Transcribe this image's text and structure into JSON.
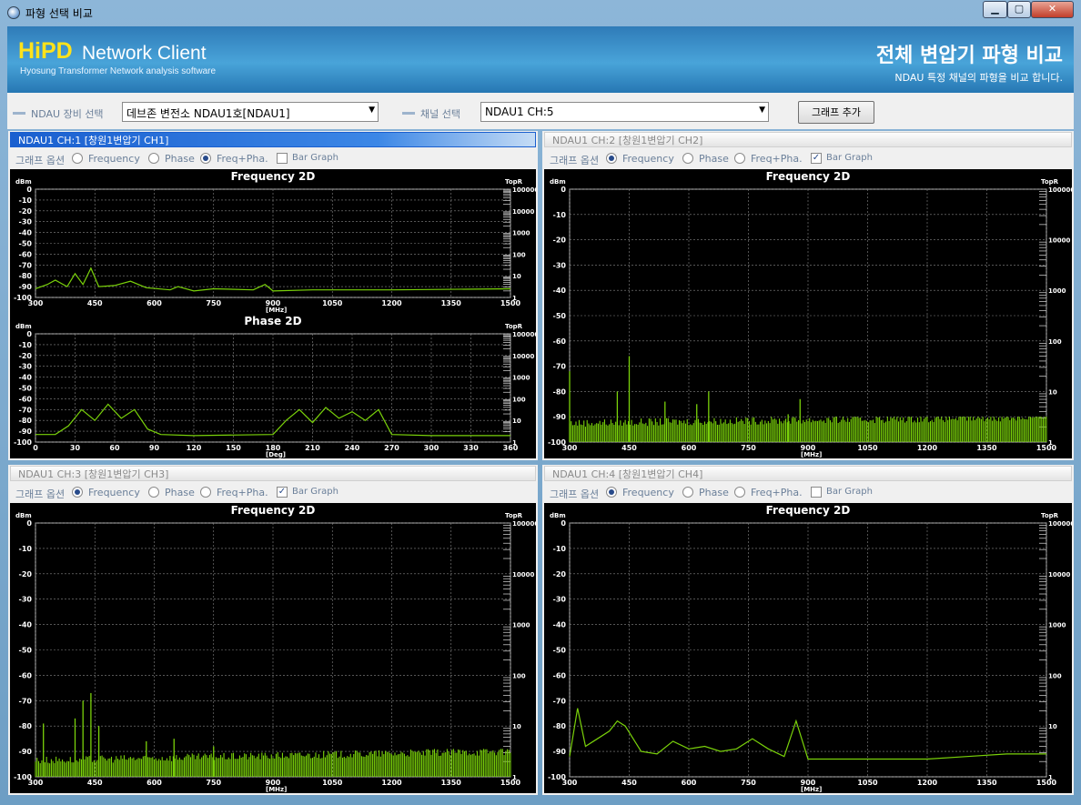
{
  "window": {
    "title": "파형 선택 비교",
    "min_glyph": "▁",
    "max_glyph": "▢",
    "close_glyph": "✕"
  },
  "header": {
    "logo_hi": "HiPD",
    "logo_rest": "Network Client",
    "logo_sub": "Hyosung Transformer Network analysis software",
    "title": "전체 변압기 파형 비교",
    "subtitle": "NDAU 특정 채널의 파형을 비교 합니다."
  },
  "toolbar": {
    "device_label": "NDAU 장비 선택",
    "device_value": "데브존 변전소 NDAU1호[NDAU1]",
    "channel_label": "채널 선택",
    "channel_value": "NDAU1 CH:5",
    "add_button": "그래프 추가"
  },
  "colors": {
    "accent": "#1a5fcf",
    "trace": "#7ad20a",
    "grid": "#a0a0a0"
  },
  "options": {
    "group_label": "그래프 옵션",
    "frequency": "Frequency",
    "phase": "Phase",
    "freqpha": "Freq+Pha.",
    "bargraph": "Bar Graph"
  },
  "panels": [
    {
      "title": "NDAU1 CH:1 [창원1변압기 CH1]",
      "active": true,
      "selected": "freqpha",
      "bar": false
    },
    {
      "title": "NDAU1 CH:2 [창원1변압기 CH2]",
      "active": false,
      "selected": "frequency",
      "bar": true
    },
    {
      "title": "NDAU1 CH:3 [창원1변압기 CH3]",
      "active": false,
      "selected": "frequency",
      "bar": true
    },
    {
      "title": "NDAU1 CH:4 [창원1변압기 CH4]",
      "active": false,
      "selected": "frequency",
      "bar": false
    }
  ],
  "chart_data": [
    {
      "type": "line",
      "title": "Frequency 2D",
      "ylabel": "dBm",
      "y2label": "TopR",
      "xlabel": "[MHz]",
      "xlim": [
        300,
        1500
      ],
      "ylim": [
        -100,
        0
      ],
      "x_ticks": [
        300,
        450,
        600,
        750,
        900,
        1050,
        1200,
        1350,
        1500
      ],
      "y_ticks": [
        0,
        -10,
        -20,
        -30,
        -40,
        -50,
        -60,
        -70,
        -80,
        -90,
        -100
      ],
      "y2_ticks": [
        "100000",
        "10000",
        "1000",
        "100",
        "10",
        "1"
      ],
      "series": [
        {
          "x": [
            300,
            330,
            350,
            380,
            400,
            420,
            440,
            460,
            500,
            540,
            580,
            640,
            660,
            700,
            750,
            850,
            880,
            900,
            1000,
            1200,
            1500
          ],
          "y": [
            -92,
            -88,
            -84,
            -90,
            -78,
            -88,
            -73,
            -90,
            -89,
            -85,
            -91,
            -93,
            -90,
            -94,
            -92,
            -93,
            -88,
            -94,
            -93,
            -93,
            -92
          ]
        }
      ]
    },
    {
      "type": "line",
      "title": "Phase 2D",
      "ylabel": "dBm",
      "y2label": "TopR",
      "xlabel": "[Deg]",
      "xlim": [
        0,
        360
      ],
      "ylim": [
        -100,
        0
      ],
      "x_ticks": [
        0,
        30,
        60,
        90,
        120,
        150,
        180,
        210,
        240,
        270,
        300,
        330,
        360
      ],
      "y_ticks": [
        0,
        -10,
        -20,
        -30,
        -40,
        -50,
        -60,
        -70,
        -80,
        -90,
        -100
      ],
      "y2_ticks": [
        "100000",
        "10000",
        "1000",
        "100",
        "10",
        "1"
      ],
      "series": [
        {
          "x": [
            0,
            15,
            25,
            35,
            45,
            55,
            65,
            75,
            85,
            95,
            120,
            180,
            190,
            200,
            210,
            220,
            230,
            240,
            250,
            260,
            270,
            300,
            360
          ],
          "y": [
            -93,
            -93,
            -85,
            -70,
            -80,
            -65,
            -78,
            -70,
            -88,
            -93,
            -94,
            -93,
            -80,
            -70,
            -82,
            -68,
            -78,
            -72,
            -80,
            -70,
            -93,
            -94,
            -94
          ]
        }
      ]
    },
    {
      "type": "bar",
      "title": "Frequency 2D",
      "ylabel": "dBm",
      "y2label": "TopR",
      "xlabel": "[MHz]",
      "xlim": [
        300,
        1500
      ],
      "ylim": [
        -100,
        0
      ],
      "x_ticks": [
        300,
        450,
        600,
        750,
        900,
        1050,
        1200,
        1350,
        1500
      ],
      "y_ticks": [
        0,
        -10,
        -20,
        -30,
        -40,
        -50,
        -60,
        -70,
        -80,
        -90,
        -100
      ],
      "y2_ticks": [
        "100000",
        "10000",
        "1000",
        "100",
        "10",
        "1"
      ],
      "peaks": [
        {
          "x": 300,
          "y": -72
        },
        {
          "x": 420,
          "y": -80
        },
        {
          "x": 450,
          "y": -66
        },
        {
          "x": 540,
          "y": -84
        },
        {
          "x": 620,
          "y": -85
        },
        {
          "x": 650,
          "y": -80
        },
        {
          "x": 850,
          "y": -89
        },
        {
          "x": 880,
          "y": -83
        }
      ],
      "floor": [
        -94,
        -90
      ]
    },
    {
      "type": "bar",
      "title": "Frequency 2D",
      "ylabel": "dBm",
      "y2label": "TopR",
      "xlabel": "[MHz]",
      "xlim": [
        300,
        1500
      ],
      "ylim": [
        -100,
        0
      ],
      "x_ticks": [
        300,
        450,
        600,
        750,
        900,
        1050,
        1200,
        1350,
        1500
      ],
      "y_ticks": [
        0,
        -10,
        -20,
        -30,
        -40,
        -50,
        -60,
        -70,
        -80,
        -90,
        -100
      ],
      "y2_ticks": [
        "100000",
        "10000",
        "1000",
        "100",
        "10",
        "1"
      ],
      "peaks": [
        {
          "x": 320,
          "y": -79
        },
        {
          "x": 400,
          "y": -77
        },
        {
          "x": 420,
          "y": -70
        },
        {
          "x": 440,
          "y": -67
        },
        {
          "x": 460,
          "y": -80
        },
        {
          "x": 580,
          "y": -86
        },
        {
          "x": 650,
          "y": -85
        },
        {
          "x": 750,
          "y": -88
        }
      ],
      "floor": [
        -95,
        -89
      ]
    },
    {
      "type": "line",
      "title": "Frequency 2D",
      "ylabel": "dBm",
      "y2label": "TopR",
      "xlabel": "[MHz]",
      "xlim": [
        300,
        1500
      ],
      "ylim": [
        -100,
        0
      ],
      "x_ticks": [
        300,
        450,
        600,
        750,
        900,
        1050,
        1200,
        1350,
        1500
      ],
      "y_ticks": [
        0,
        -10,
        -20,
        -30,
        -40,
        -50,
        -60,
        -70,
        -80,
        -90,
        -100
      ],
      "y2_ticks": [
        "100000",
        "10000",
        "1000",
        "100",
        "10",
        "1"
      ],
      "series": [
        {
          "x": [
            300,
            320,
            340,
            360,
            400,
            420,
            440,
            480,
            520,
            560,
            600,
            640,
            680,
            720,
            760,
            800,
            840,
            870,
            900,
            1000,
            1100,
            1200,
            1300,
            1400,
            1500
          ],
          "y": [
            -92,
            -73,
            -88,
            -86,
            -82,
            -78,
            -80,
            -90,
            -91,
            -86,
            -89,
            -88,
            -90,
            -89,
            -85,
            -89,
            -92,
            -78,
            -93,
            -93,
            -93,
            -93,
            -92,
            -91,
            -91
          ]
        }
      ]
    },
    {
      "type": "line",
      "title": "Frequency 2D",
      "ylabel": "dBm",
      "y2label": "TopR",
      "xlabel": "[MHz]",
      "xlim": [
        300,
        1500
      ],
      "ylim": [
        -100,
        0
      ],
      "x_ticks": [
        300,
        450,
        600,
        750,
        900,
        1050,
        1200,
        1350,
        1500
      ],
      "y_ticks": [
        0,
        -10,
        -20,
        -30,
        -40,
        -50,
        -60,
        -70,
        -80,
        -90,
        -100
      ],
      "y2_ticks": [
        "100000",
        "10000",
        "1000",
        "100",
        "10",
        "1"
      ],
      "series": [
        {
          "x": [
            300,
            330,
            350,
            400,
            420,
            440,
            460,
            480,
            520,
            560,
            600,
            640,
            700,
            750,
            800,
            850,
            880,
            900,
            1000,
            1100,
            1200,
            1300,
            1400,
            1500
          ],
          "y": [
            -92,
            -72,
            -85,
            -79,
            -80,
            -78,
            -88,
            -93,
            -93,
            -88,
            -90,
            -88,
            -91,
            -86,
            -90,
            -88,
            -80,
            -93,
            -93,
            -93,
            -93,
            -92,
            -91,
            -91
          ]
        }
      ]
    }
  ]
}
